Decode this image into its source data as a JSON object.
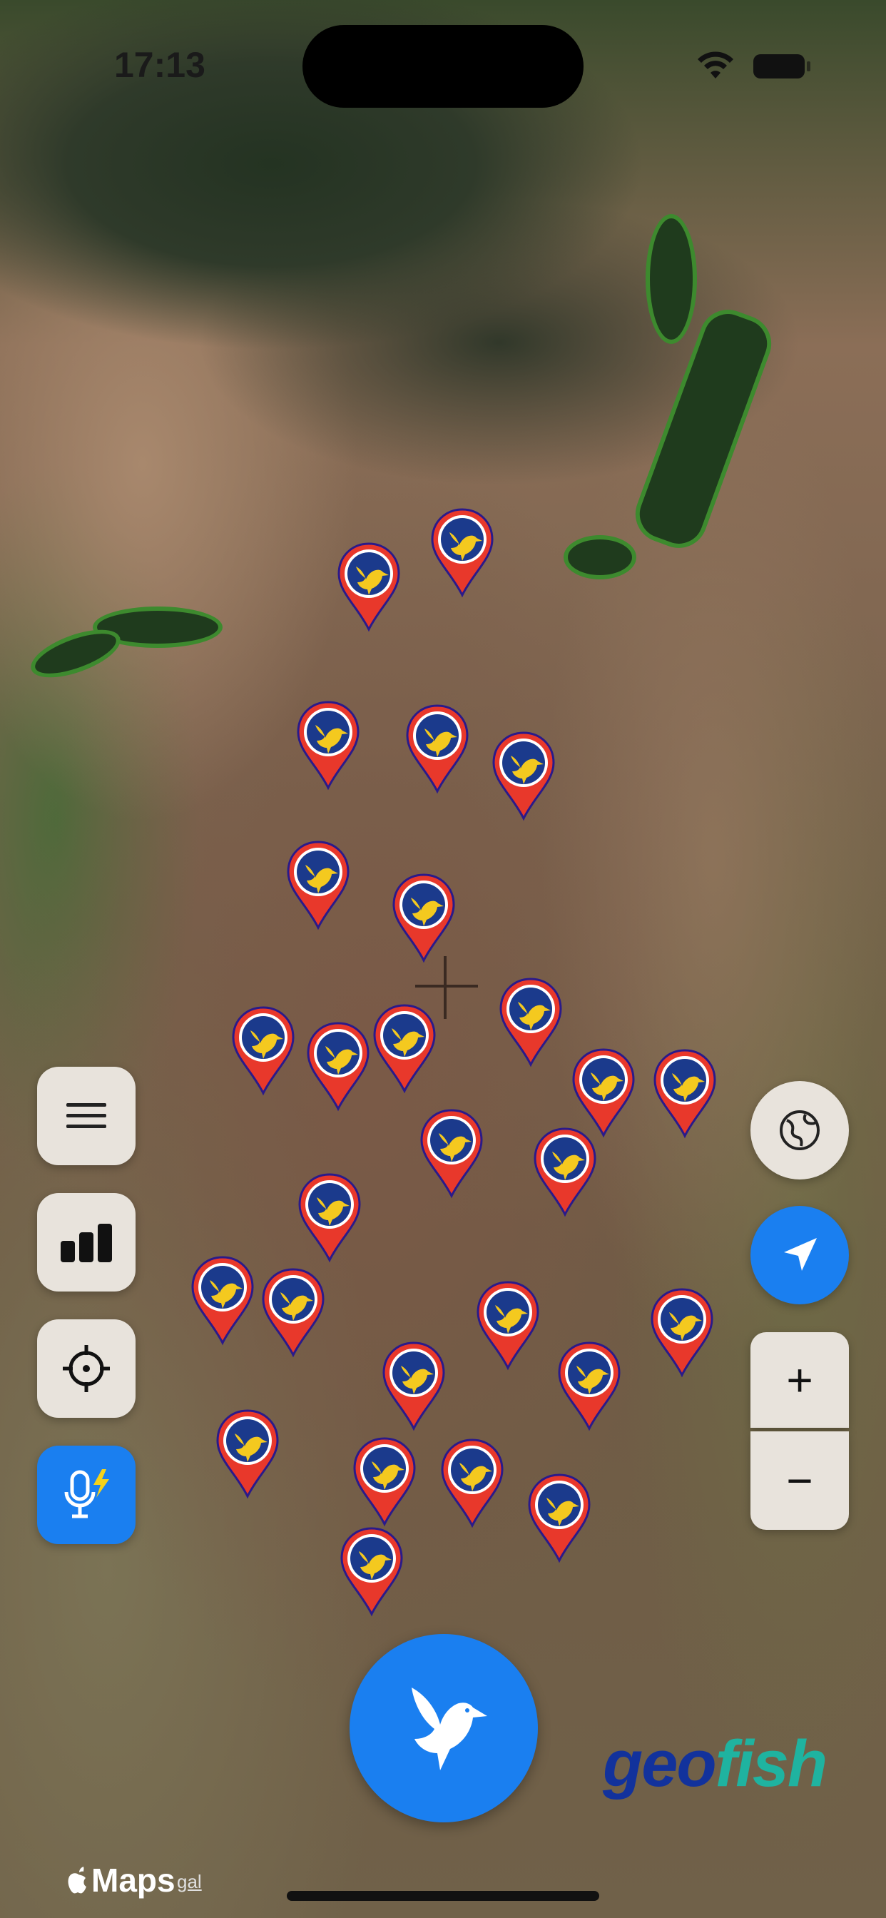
{
  "status_bar": {
    "time": "17:13"
  },
  "map": {
    "attribution_logo": "Maps",
    "legal_link": "gal",
    "pin_icon": "bird-icon",
    "pin_color": "#e8382b",
    "pin_badge_color": "#1b3a8c",
    "pin_bird_color": "#f4c91f"
  },
  "left_controls": [
    {
      "icon": "menu-icon"
    },
    {
      "icon": "bar-chart-icon"
    },
    {
      "icon": "crosshair-icon"
    },
    {
      "icon": "voice-lightning-icon"
    }
  ],
  "right_controls": [
    {
      "icon": "globe-icon"
    },
    {
      "icon": "location-arrow-icon"
    },
    {
      "icon": "zoom-in-icon",
      "label": "+"
    },
    {
      "icon": "zoom-out-icon",
      "label": "−"
    }
  ],
  "fab": {
    "icon": "bird-icon"
  },
  "brand": {
    "part1": "geo",
    "part2": "fish"
  },
  "colors": {
    "accent": "#1a7ff0",
    "control_bg": "#e8e3dc"
  }
}
